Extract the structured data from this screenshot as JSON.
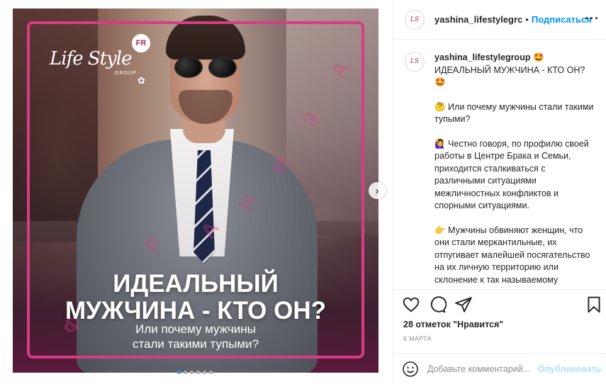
{
  "media": {
    "logo_text": "Life Style",
    "logo_sub": "GROUP",
    "badge": "FR",
    "headline_line1": "ИДЕАЛЬНЫЙ",
    "headline_line2": "МУЖЧИНА - КТО ОН?",
    "subline_line1": "Или почему мужчины",
    "subline_line2": "стали такими тупыми?",
    "watermark_letters": [
      "А",
      "З",
      "И",
      "Н",
      "А",
      "Р",
      "Ф"
    ],
    "carousel": {
      "count": 6,
      "active_index": 0
    },
    "accent_color": "#d93b86"
  },
  "header": {
    "username": "yashina_lifestylegrc",
    "separator": "•",
    "follow_label": "Подписаться",
    "more_label": "···"
  },
  "caption": {
    "username": "yashina_lifestylegroup",
    "paragraphs": [
      "🤩 ИДЕАЛЬНЫЙ МУЖЧИНА - КТО ОН? 🤩",
      "🤔 Или почему мужчины стали такими тупыми?",
      "🙋‍♀️ Честно говоря, по профилю своей работы в Центре Брака и Семьи, приходится сталкиваться с различными ситуациями межличностных конфликтов и спорными ситуациями.",
      "👉 Мужчины обвиняют женщин, что они стали меркантильные, их отпугивает малейшей посягательство на их личную территорию или склонение к так называемому"
    ]
  },
  "actions": {
    "like_icon": "heart-icon",
    "comment_icon": "comment-icon",
    "share_icon": "paper-plane-icon",
    "save_icon": "bookmark-icon"
  },
  "likes_text": "28 отметок \"Нравится\"",
  "date_text": "6 МАРТА",
  "comment": {
    "placeholder": "Добавьте комментарий...",
    "publish_label": "Опубликовать"
  }
}
